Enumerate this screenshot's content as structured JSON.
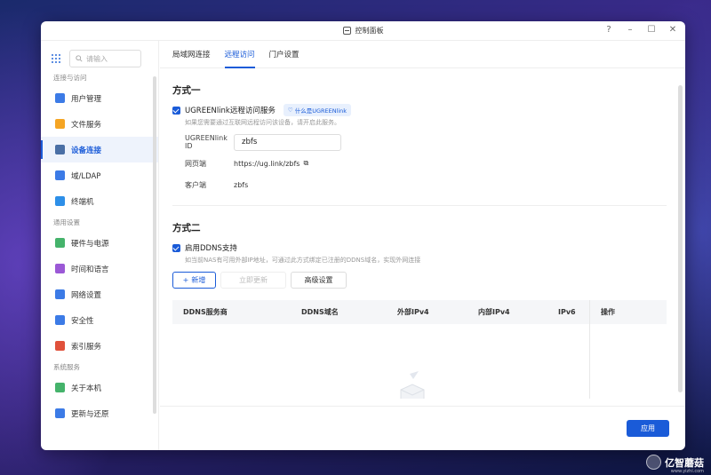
{
  "window": {
    "title": "控制面板"
  },
  "sidebar": {
    "search_placeholder": "请输入",
    "sections": [
      {
        "label": "连接与访问",
        "items": [
          {
            "label": "用户管理",
            "icon": "user-manage-icon",
            "color": "#3c7be6"
          },
          {
            "label": "文件服务",
            "icon": "file-service-icon",
            "color": "#f5a524"
          },
          {
            "label": "设备连接",
            "icon": "device-connect-icon",
            "color": "#4a6fa5",
            "active": true
          },
          {
            "label": "域/LDAP",
            "icon": "ldap-icon",
            "color": "#3c7be6"
          },
          {
            "label": "终端机",
            "icon": "terminal-icon",
            "color": "#2d8fe8"
          }
        ]
      },
      {
        "label": "通用设置",
        "items": [
          {
            "label": "硬件与电源",
            "icon": "hardware-power-icon",
            "color": "#45b36b"
          },
          {
            "label": "时间和语言",
            "icon": "time-language-icon",
            "color": "#9b59d6"
          },
          {
            "label": "网络设置",
            "icon": "network-icon",
            "color": "#3c7be6"
          },
          {
            "label": "安全性",
            "icon": "security-shield-icon",
            "color": "#3c7be6"
          },
          {
            "label": "索引服务",
            "icon": "index-service-icon",
            "color": "#e0513b"
          }
        ]
      },
      {
        "label": "系统服务",
        "items": [
          {
            "label": "关于本机",
            "icon": "about-info-icon",
            "color": "#45b36b"
          },
          {
            "label": "更新与还原",
            "icon": "update-restore-icon",
            "color": "#3c7be6"
          }
        ]
      }
    ]
  },
  "tabs": [
    "局域网连接",
    "远程访问",
    "门户设置"
  ],
  "method1": {
    "title": "方式一",
    "checkbox_label": "UGREENlink远程访问服务",
    "help_pill": "什么是UGREENlink",
    "hint": "如果您需要通过互联网远程访问该设备，请开启此服务。",
    "id_label": "UGREENlink ID",
    "id_value": "zbfs",
    "web_label": "网页端",
    "web_value": "https://ug.link/zbfs",
    "client_label": "客户端",
    "client_value": "zbfs"
  },
  "method2": {
    "title": "方式二",
    "checkbox_label": "启用DDNS支持",
    "hint": "如当前NAS有可用外部IP地址，可通过此方式绑定已注册的DDNS域名，实现外网连接",
    "buttons": {
      "add": "新增",
      "update": "立即更新",
      "advanced": "高级设置"
    },
    "table_headers": [
      "DDNS服务商",
      "DDNS域名",
      "外部IPv4",
      "内部IPv4",
      "IPv6",
      "操作"
    ]
  },
  "footer": {
    "apply": "应用"
  },
  "watermark": {
    "text": "亿智蘑菇",
    "sub": "www.yizhi.com"
  },
  "colors": {
    "accent": "#1a5bd8"
  }
}
